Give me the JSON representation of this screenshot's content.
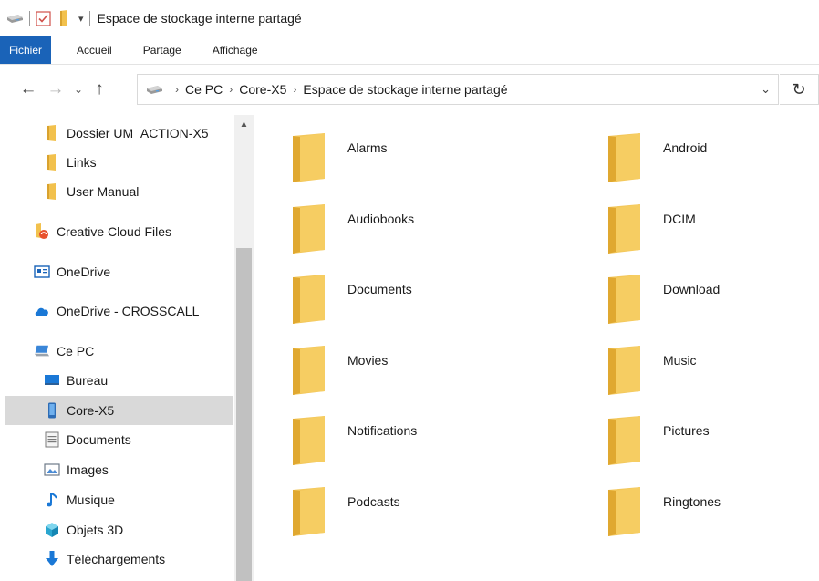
{
  "window": {
    "title": "Espace de stockage interne partagé"
  },
  "ribbon": {
    "tabs": [
      "Fichier",
      "Accueil",
      "Partage",
      "Affichage"
    ]
  },
  "address": {
    "crumbs": [
      "Ce PC",
      "Core-X5",
      "Espace de stockage interne partagé"
    ]
  },
  "sidebar": {
    "items": [
      {
        "label": "Dossier UM_ACTION-X5_",
        "icon": "folder-icon",
        "indent": true
      },
      {
        "label": "Links",
        "icon": "folder-icon",
        "indent": true
      },
      {
        "label": "User Manual",
        "icon": "folder-icon",
        "indent": true
      },
      {
        "label": "Creative Cloud Files",
        "icon": "creative-cloud-icon",
        "indent": false
      },
      {
        "label": "OneDrive",
        "icon": "onedrive-box-icon",
        "indent": false
      },
      {
        "label": "OneDrive - CROSSCALL",
        "icon": "cloud-icon",
        "indent": false
      },
      {
        "label": "Ce PC",
        "icon": "computer-icon",
        "indent": false
      },
      {
        "label": "Bureau",
        "icon": "desktop-icon",
        "indent": true
      },
      {
        "label": "Core-X5",
        "icon": "phone-icon",
        "indent": true,
        "selected": true
      },
      {
        "label": "Documents",
        "icon": "documents-icon",
        "indent": true
      },
      {
        "label": "Images",
        "icon": "images-icon",
        "indent": true
      },
      {
        "label": "Musique",
        "icon": "music-icon",
        "indent": true
      },
      {
        "label": "Objets 3D",
        "icon": "cube-3d-icon",
        "indent": true
      },
      {
        "label": "Téléchargements",
        "icon": "download-arrow-icon",
        "indent": true
      }
    ]
  },
  "folders": [
    "Alarms",
    "Android",
    "Audiobooks",
    "DCIM",
    "Documents",
    "Download",
    "Movies",
    "Music",
    "Notifications",
    "Pictures",
    "Podcasts",
    "Ringtones"
  ],
  "colors": {
    "accent": "#1a63b8",
    "folder": "#f5c451",
    "selected": "#d9d9d9"
  }
}
